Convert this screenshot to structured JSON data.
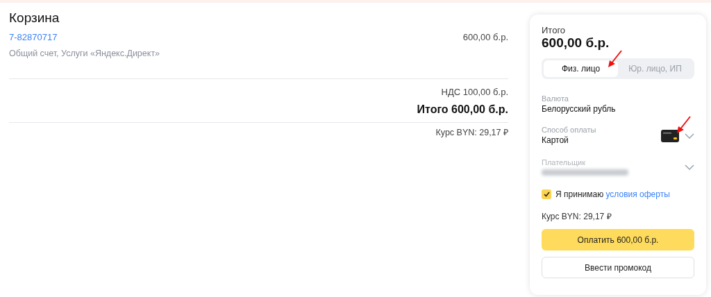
{
  "cart": {
    "title": "Корзина",
    "item": {
      "number": "7-82870717",
      "description": "Общий счет, Услуги «Яндекс.Директ»",
      "price": "600,00 б.р."
    },
    "vat": "НДС 100,00 б.р.",
    "total": "Итого 600,00 б.р.",
    "rate": "Курс BYN: 29,17 ₽"
  },
  "summary": {
    "label": "Итого",
    "amount": "600,00 б.р.",
    "tabs": [
      {
        "label": "Физ. лицо",
        "selected": true
      },
      {
        "label": "Юр. лицо, ИП",
        "selected": false
      }
    ],
    "currency": {
      "label": "Валюта",
      "value": "Белорусский рубль"
    },
    "payment": {
      "label": "Способ оплаты",
      "value": "Картой"
    },
    "payer": {
      "label": "Плательщик"
    },
    "agree": {
      "checked": true,
      "text": "Я принимаю",
      "link": "условия оферты"
    },
    "rate": "Курс BYN: 29,17 ₽",
    "pay_button": "Оплатить 600,00 б.р.",
    "promo_button": "Ввести промокод"
  }
}
